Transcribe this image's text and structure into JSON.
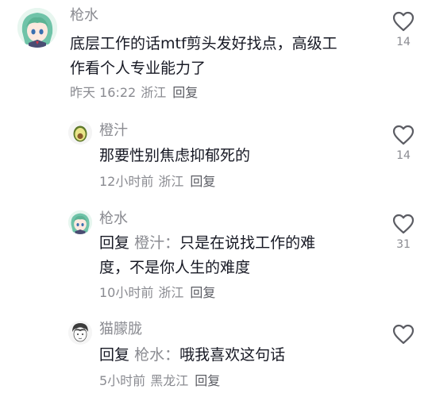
{
  "comments": [
    {
      "username": "枪水",
      "text": "底层工作的话mtf剪头发好找点，高级工\n作看个人专业能力了",
      "time": "昨天 16:22",
      "location": "浙江",
      "reply_label": "回复",
      "likes": "14",
      "avatar_icon": "anime-girl-avatar"
    },
    {
      "username": "橙汁",
      "text": "那要性别焦虑抑郁死的",
      "time": "12小时前",
      "location": "浙江",
      "reply_label": "回复",
      "likes": "14",
      "avatar_icon": "avocado-avatar"
    },
    {
      "username": "枪水",
      "reply_prefix": "回复",
      "reply_target": "橙汁：",
      "text": "只是在说找工作的难\n度，不是你人生的难度",
      "time": "10小时前",
      "location": "浙江",
      "reply_label": "回复",
      "likes": "31",
      "avatar_icon": "anime-girl-avatar"
    },
    {
      "username": "猫朦胧",
      "reply_prefix": "回复",
      "reply_target": "枪水：",
      "text": "哦我喜欢这句话",
      "time": "5小时前",
      "location": "黑龙江",
      "reply_label": "回复",
      "likes": "",
      "avatar_icon": "sketch-boy-avatar"
    }
  ],
  "colors": {
    "text": "#161823",
    "muted": "#8a8b91",
    "heart_stroke": "#5b5c63"
  },
  "icons": {
    "like": "heart-outline-icon"
  }
}
